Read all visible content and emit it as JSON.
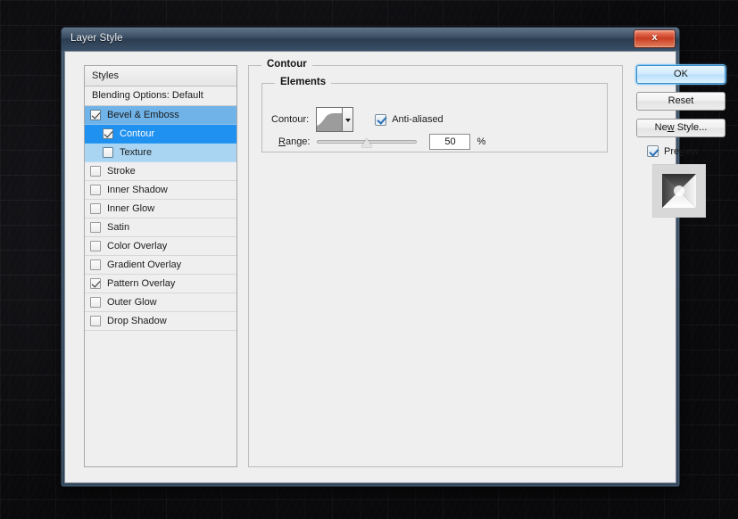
{
  "window": {
    "title": "Layer Style",
    "close_label": "x",
    "close_icon": "close-icon"
  },
  "styles_panel": {
    "header": "Styles",
    "blending_options": "Blending Options: Default",
    "items": [
      {
        "label": "Bevel & Emboss",
        "checked": true,
        "indent": false,
        "state": "parent"
      },
      {
        "label": "Contour",
        "checked": true,
        "indent": true,
        "state": "active"
      },
      {
        "label": "Texture",
        "checked": false,
        "indent": true,
        "state": "child"
      },
      {
        "label": "Stroke",
        "checked": false,
        "indent": false,
        "state": "none"
      },
      {
        "label": "Inner Shadow",
        "checked": false,
        "indent": false,
        "state": "none"
      },
      {
        "label": "Inner Glow",
        "checked": false,
        "indent": false,
        "state": "none"
      },
      {
        "label": "Satin",
        "checked": false,
        "indent": false,
        "state": "none"
      },
      {
        "label": "Color Overlay",
        "checked": false,
        "indent": false,
        "state": "none"
      },
      {
        "label": "Gradient Overlay",
        "checked": false,
        "indent": false,
        "state": "none"
      },
      {
        "label": "Pattern Overlay",
        "checked": true,
        "indent": false,
        "state": "none"
      },
      {
        "label": "Outer Glow",
        "checked": false,
        "indent": false,
        "state": "none"
      },
      {
        "label": "Drop Shadow",
        "checked": false,
        "indent": false,
        "state": "none"
      }
    ]
  },
  "contour_panel": {
    "group_title": "Contour",
    "elements_title": "Elements",
    "contour_label": "Contour:",
    "contour_swatch_icon": "contour-curve-icon",
    "contour_dropdown_icon": "chevron-down-icon",
    "antialiased_label": "Anti-aliased",
    "antialiased_checked": true,
    "range_label": "Range:",
    "range_value": "50",
    "range_unit": "%",
    "range_percent": 50
  },
  "buttons": {
    "ok": "OK",
    "reset": "Reset",
    "new_style": "New Style...",
    "preview_label": "Preview",
    "preview_checked": true,
    "preview_thumb_icon": "bevel-emboss-preview-icon"
  },
  "colors": {
    "accent_selected": "#1f91f0",
    "accent_parent": "#6fb3e8",
    "accent_child": "#a9d5f3",
    "dialog_bg": "#efefef",
    "titlebar": "#32465c",
    "close_button": "#c43b22",
    "default_button_border": "#3d8fc9"
  }
}
